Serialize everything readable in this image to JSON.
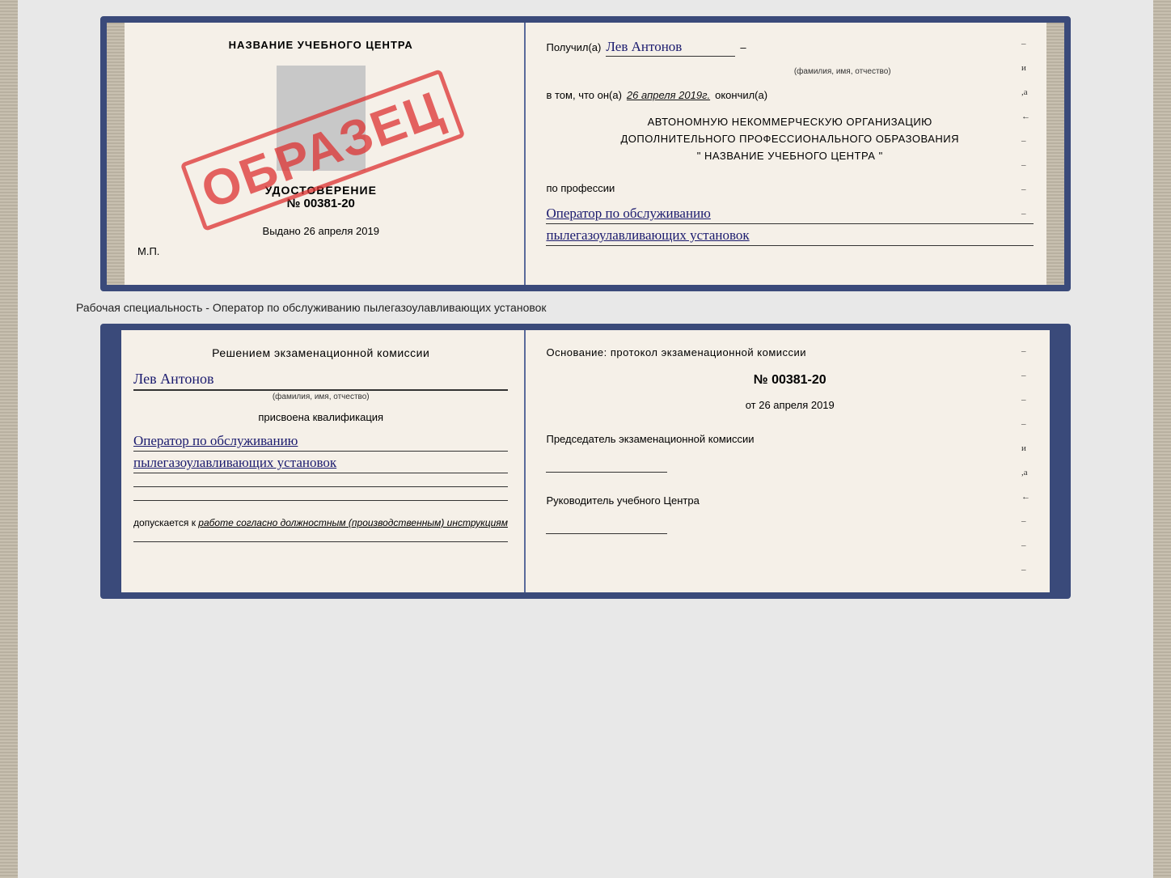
{
  "top_book": {
    "left": {
      "title": "НАЗВАНИЕ УЧЕБНОГО ЦЕНТРА",
      "stamp": "ОБРАЗЕЦ",
      "udostoverenie_label": "УДОСТОВЕРЕНИЕ",
      "udostoverenie_num": "№ 00381-20",
      "vydano_label": "Выдано",
      "vydano_date": "26 апреля 2019",
      "mp_label": "М.П."
    },
    "right": {
      "poluchil_label": "Получил(а)",
      "poluchil_name": "Лев Антонов",
      "fio_sublabel": "(фамилия, имя, отчество)",
      "dash1": "–",
      "vtom_label": "в том, что он(а)",
      "vtom_date": "26 апреля 2019г.",
      "okonchil_label": "окончил(а)",
      "dash2": "–",
      "org_line1": "АВТОНОМНУЮ НЕКОММЕРЧЕСКУЮ ОРГАНИЗАЦИЮ",
      "org_line2": "ДОПОЛНИТЕЛЬНОГО ПРОФЕССИОНАЛЬНОГО ОБРАЗОВАНИЯ",
      "org_line3": "\"  НАЗВАНИЕ УЧЕБНОГО ЦЕНТРА  \"",
      "dash3": "–",
      "i_mark": "и",
      "a_mark": ",а",
      "arrow_mark": "←",
      "po_professii_label": "по профессии",
      "profession_line1": "Оператор по обслуживанию",
      "profession_line2": "пылегазоулавливающих установок",
      "dash4": "–",
      "dash5": "–",
      "dash6": "–",
      "dash7": "–"
    }
  },
  "separator": {
    "text": "Рабочая специальность - Оператор по обслуживанию пылегазоулавливающих установок"
  },
  "bottom_book": {
    "left": {
      "resheniem_label": "Решением экзаменационной комиссии",
      "name": "Лев Антонов",
      "fio_sublabel": "(фамилия, имя, отчество)",
      "prisvoena_label": "присвоена квалификация",
      "kvalif_line1": "Оператор по обслуживанию",
      "kvalif_line2": "пылегазоулавливающих установок",
      "dopuskaetsya_label": "допускается к",
      "dopuskaetsya_value": "работе согласно должностным (производственным) инструкциям"
    },
    "right": {
      "osnovaniye_label": "Основание: протокол экзаменационной комиссии",
      "protocol_num": "№  00381-20",
      "protocol_date_prefix": "от",
      "protocol_date": "26 апреля 2019",
      "dash1": "–",
      "predsedatel_label": "Председатель экзаменационной комиссии",
      "dash2": "–",
      "dash3": "–",
      "dash4": "–",
      "i_mark": "и",
      "a_mark": ",а",
      "arrow_mark": "←",
      "rukovoditel_label": "Руководитель учебного Центра",
      "dash5": "–",
      "dash6": "–",
      "dash7": "–"
    }
  }
}
